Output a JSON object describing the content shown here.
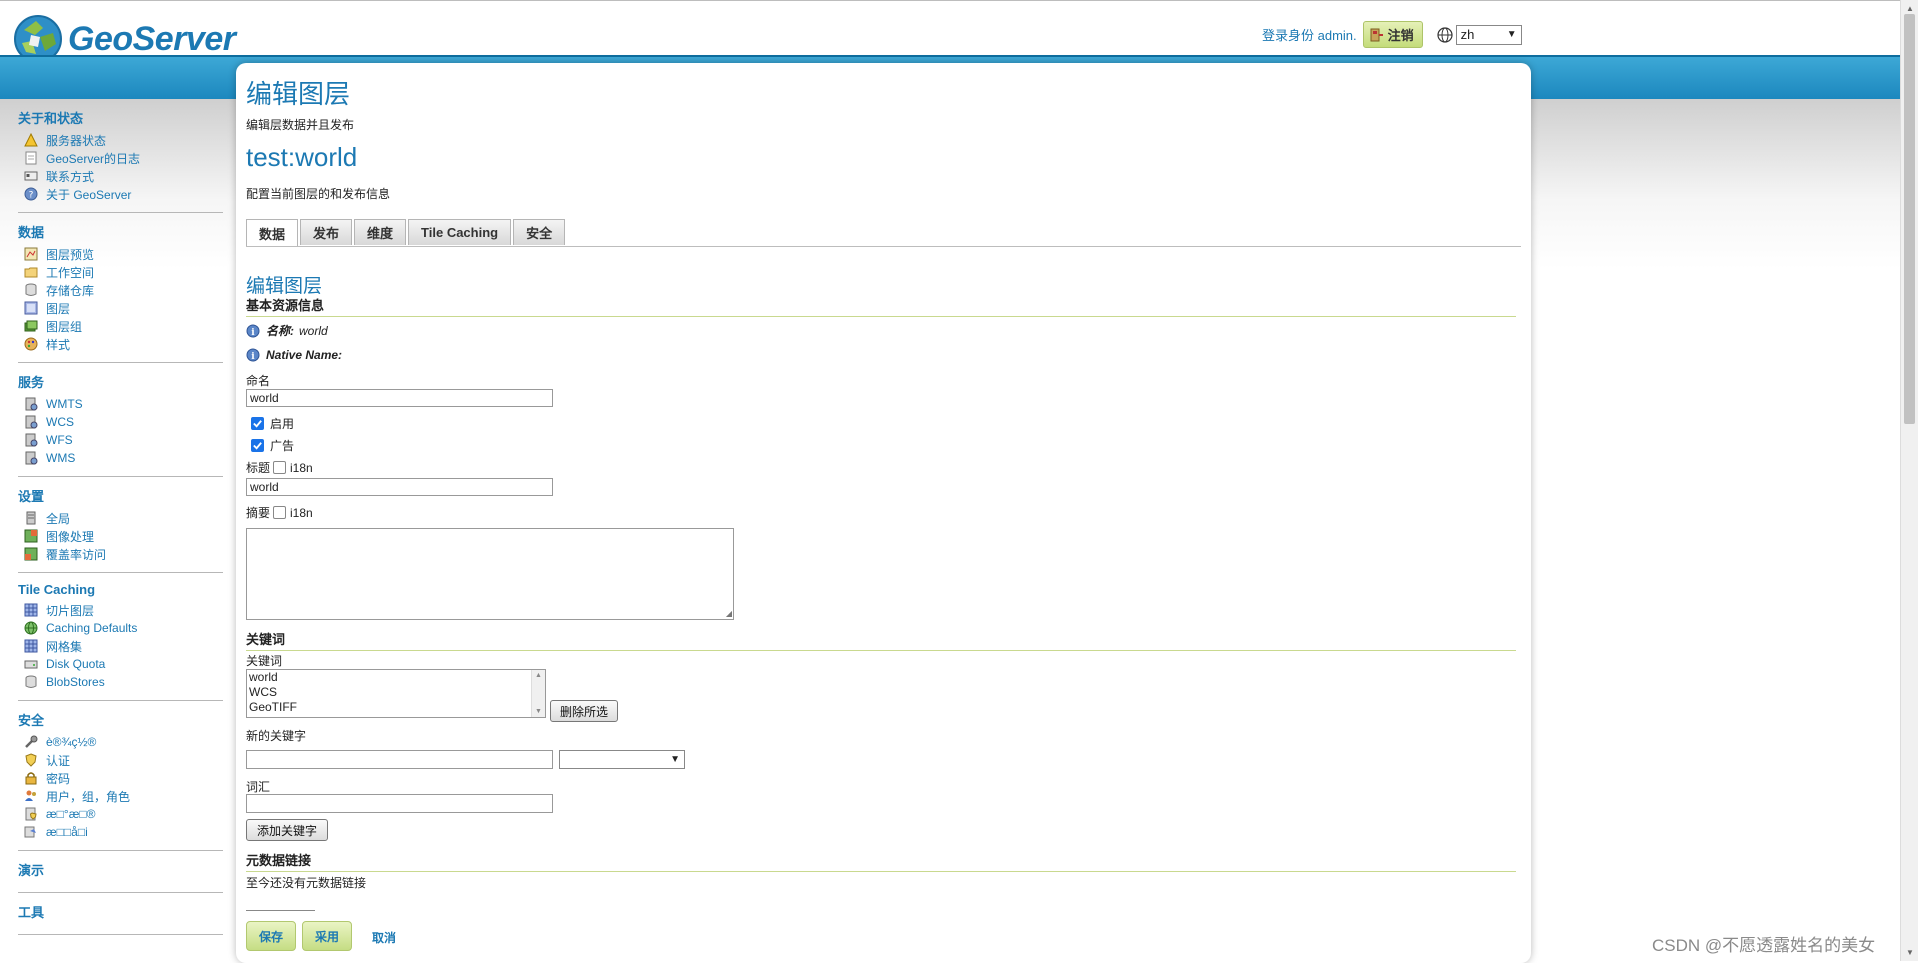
{
  "app": {
    "logo_text": "GeoServer",
    "login_text": "登录身份 admin.",
    "logout_label": "注销",
    "language": "zh"
  },
  "sidebar": {
    "sections": [
      {
        "title": "关于和状态",
        "items": [
          "服务器状态",
          "GeoServer的日志",
          "联系方式",
          "关于 GeoServer"
        ]
      },
      {
        "title": "数据",
        "items": [
          "图层预览",
          "工作空间",
          "存储仓库",
          "图层",
          "图层组",
          "样式"
        ]
      },
      {
        "title": "服务",
        "items": [
          "WMTS",
          "WCS",
          "WFS",
          "WMS"
        ]
      },
      {
        "title": "设置",
        "items": [
          "全局",
          "图像处理",
          "覆盖率访问"
        ]
      },
      {
        "title": "Tile Caching",
        "items": [
          "切片图层",
          "Caching Defaults",
          "网格集",
          "Disk Quota",
          "BlobStores"
        ]
      },
      {
        "title": "安全",
        "items": [
          "è®¾ç½®",
          "认证",
          "密码",
          "用户，组，角色",
          "æ□°æ□®",
          "æ□□å□i"
        ]
      },
      {
        "title": "演示",
        "items": []
      },
      {
        "title": "工具",
        "items": []
      }
    ]
  },
  "page": {
    "title": "编辑图层",
    "description": "编辑层数据并且发布",
    "layer_title": "test:world",
    "layer_description": "配置当前图层的和发布信息"
  },
  "tabs": [
    "数据",
    "发布",
    "维度",
    "Tile Caching",
    "安全"
  ],
  "form": {
    "title": "编辑图层",
    "basic_section": "基本资源信息",
    "name_info_label": "名称:",
    "name_info_value": "world",
    "native_name_label": "Native Name:",
    "name_label": "命名",
    "name_value": "world",
    "enabled_label": "启用",
    "advertised_label": "广告",
    "title_label": "标题",
    "title_value": "world",
    "abstract_label": "摘要",
    "i18n_label": "i18n",
    "keywords_section": "关键词",
    "keywords_label": "关键词",
    "keywords": [
      "world",
      "WCS",
      "GeoTIFF"
    ],
    "remove_selected": "删除所选",
    "new_keyword_label": "新的关键字",
    "vocabulary_label": "词汇",
    "add_keyword": "添加关键字",
    "metadata_section": "元数据链接",
    "no_metadata": "至今还没有元数据链接"
  },
  "actions": {
    "save": "保存",
    "apply": "采用",
    "cancel": "取消"
  },
  "watermark": "CSDN @不愿透露姓名的美女"
}
